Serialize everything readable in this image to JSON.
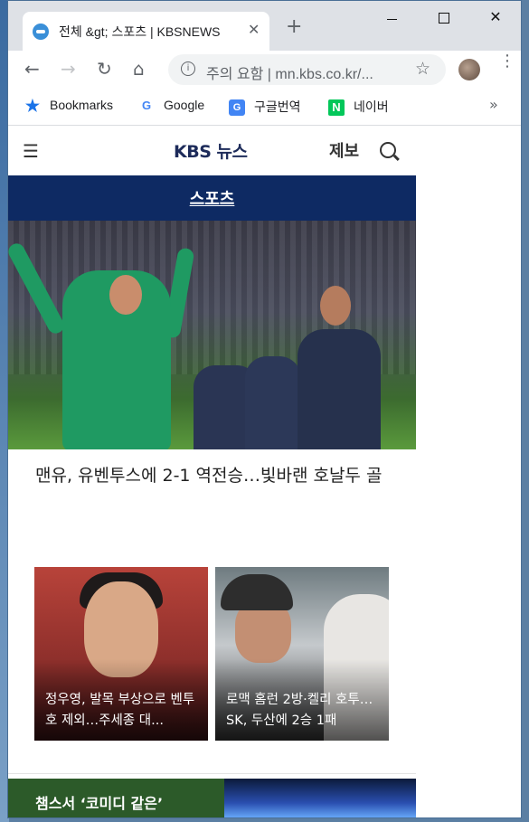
{
  "browser": {
    "tab_title": "전체 &gt; 스포츠 | KBSNEWS",
    "tab_close": "✕",
    "new_tab": "+",
    "url_prefix": "주의 요함",
    "url": "mn.kbs.co.kr/...",
    "omnibox_text": "주의 요함 | mn.kbs.co.kr/...",
    "bookmarks": [
      {
        "label": "Bookmarks",
        "icon": "star-icon"
      },
      {
        "label": "Google",
        "icon": "google-icon"
      },
      {
        "label": "구글번역",
        "icon": "translate-icon"
      },
      {
        "label": "네이버",
        "icon": "naver-icon"
      }
    ],
    "bookmarks_more": "»"
  },
  "site": {
    "logo": "KBS 뉴스",
    "report_label": "제보",
    "section": "스포츠"
  },
  "hero": {
    "caption": "맨유, 유벤투스에 2-1 역전승…빛바랜 호날두 골"
  },
  "thumbs": [
    {
      "caption": "정우영, 발목 부상으로 벤투호 제외…주세종 대..."
    },
    {
      "caption": "로맥 홈런 2방·켈리 호투…SK, 두산에 2승 1패"
    }
  ],
  "bottom_card": {
    "title": "챔스서 ‘코미디 같은’"
  }
}
